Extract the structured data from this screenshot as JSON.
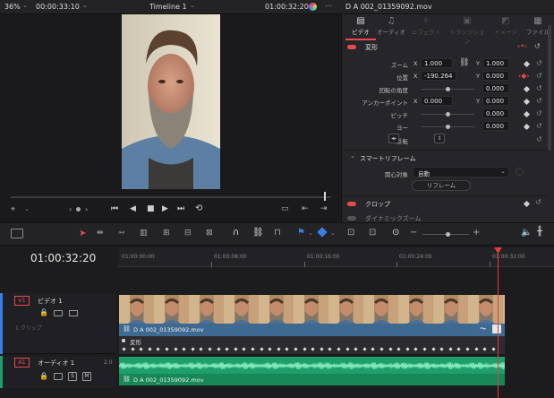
{
  "topbar": {
    "zoom": "36%",
    "source_timecode": "00:00:33:10",
    "timeline_name": "Timeline 1",
    "record_timecode": "01:00:32:20",
    "clip_name": "D A 002_01359092.mov"
  },
  "inspector": {
    "tabs": [
      {
        "label": "ビデオ",
        "icon": "video-icon",
        "active": true
      },
      {
        "label": "オーディオ",
        "icon": "music-note-icon",
        "active": false
      },
      {
        "label": "エフェクト",
        "icon": "effects-icon",
        "active": false
      },
      {
        "label": "トランジション",
        "icon": "transition-icon",
        "active": false
      },
      {
        "label": "イメージ",
        "icon": "image-icon",
        "active": false
      },
      {
        "label": "ファイル",
        "icon": "file-icon",
        "active": false
      }
    ],
    "transform_title": "変形",
    "zoom_label": "ズーム",
    "zoom_x": "1.000",
    "zoom_y": "1.000",
    "position_label": "位置",
    "position_x": "-190.264",
    "position_y": "0.000",
    "rotation_label": "回転の角度",
    "rotation_value": "0.000",
    "anchor_label": "アンカーポイント",
    "anchor_x": "0.000",
    "anchor_y": "0.000",
    "pitch_label": "ピッチ",
    "pitch_value": "0.000",
    "yaw_label": "ヨー",
    "yaw_value": "0.000",
    "flip_label": "反転",
    "x_label": "X",
    "y_label": "Y",
    "smart_reframe_title": "スマートリフレーム",
    "object_label": "関心対象",
    "object_value": "自動",
    "reframe_button": "リフレーム",
    "crop_title": "クロップ",
    "dynamic_zoom_title": "ダイナミックズーム"
  },
  "timeline": {
    "current_timecode": "01:00:32:20",
    "ruler": [
      "01:00:00:00",
      "01:00:08:00",
      "01:00:16:00",
      "01:00:24:00",
      "01:00:32:00"
    ],
    "video_track": {
      "id": "V1",
      "name": "ビデオ 1",
      "clip_count": "1 クリップ",
      "clip_name": "D A 002_01359092.mov",
      "keyframe_label": "変形"
    },
    "audio_track": {
      "id": "A1",
      "name": "オーディオ 1",
      "level": "2.0",
      "solo": "S",
      "mute": "M",
      "clip_name": "D A 002_01359092.mov"
    }
  },
  "colors": {
    "accent_red": "#e64b4b",
    "playhead": "#e53b3b",
    "video_clip": "#3c5a78",
    "audio_clip": "#1e9e6a",
    "active_tab": "#e64b4b"
  }
}
